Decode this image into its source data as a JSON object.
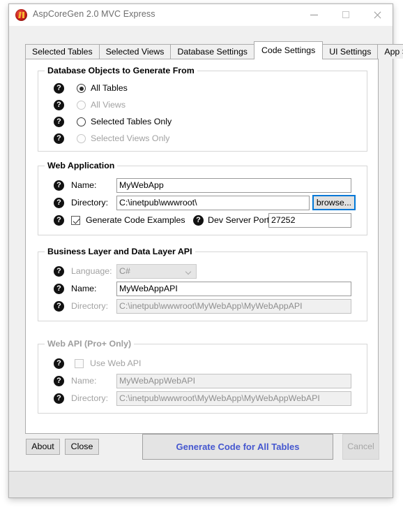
{
  "window": {
    "title": "AspCoreGen 2.0 MVC Express",
    "icon": "app-logo-icon",
    "controls": {
      "minimize": "minimize-icon",
      "maximize": "maximize-icon",
      "close": "close-icon"
    }
  },
  "tabs": [
    {
      "label": "Selected Tables",
      "active": false
    },
    {
      "label": "Selected Views",
      "active": false
    },
    {
      "label": "Database Settings",
      "active": false
    },
    {
      "label": "Code Settings",
      "active": true
    },
    {
      "label": "UI Settings",
      "active": false
    },
    {
      "label": "App Settings",
      "active": false
    }
  ],
  "groups": {
    "db_objects": {
      "title": "Database Objects to Generate From",
      "options": [
        {
          "label": "All Tables",
          "selected": true,
          "enabled": true
        },
        {
          "label": "All Views",
          "selected": false,
          "enabled": false
        },
        {
          "label": "Selected Tables Only",
          "selected": false,
          "enabled": true
        },
        {
          "label": "Selected Views Only",
          "selected": false,
          "enabled": false
        }
      ]
    },
    "web_application": {
      "title": "Web Application",
      "name_label": "Name:",
      "name_value": "MyWebApp",
      "directory_label": "Directory:",
      "directory_value": "C:\\inetpub\\wwwroot\\",
      "browse_label": "browse...",
      "generate_examples_label": "Generate Code Examples",
      "generate_examples_checked": true,
      "dev_port_label": "Dev Server Port:",
      "dev_port_value": "27252"
    },
    "business_layer": {
      "title": "Business Layer and Data Layer API",
      "language_label": "Language:",
      "language_value": "C#",
      "name_label": "Name:",
      "name_value": "MyWebAppAPI",
      "directory_label": "Directory:",
      "directory_value": "C:\\inetpub\\wwwroot\\MyWebApp\\MyWebAppAPI"
    },
    "web_api": {
      "title": "Web API (Pro+ Only)",
      "enabled": false,
      "use_web_api_label": "Use Web API",
      "use_web_api_checked": false,
      "name_label": "Name:",
      "name_value": "MyWebAppWebAPI",
      "directory_label": "Directory:",
      "directory_value": "C:\\inetpub\\wwwroot\\MyWebApp\\MyWebAppWebAPI"
    }
  },
  "footer": {
    "about_label": "About",
    "close_label": "Close",
    "generate_label": "Generate Code for All Tables",
    "cancel_label": "Cancel",
    "cancel_enabled": false
  },
  "help_glyph": "?",
  "colors": {
    "accent_blue": "#4557cf",
    "focus_blue": "#0078d7",
    "window_bg": "#f0f0f0",
    "panel_bg": "#ffffff"
  }
}
